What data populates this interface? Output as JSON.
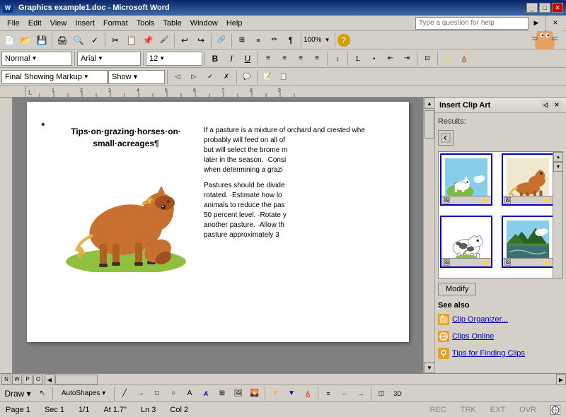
{
  "titlebar": {
    "title": "Graphics example1.doc - Microsoft Word",
    "buttons": [
      "_",
      "□",
      "✕"
    ]
  },
  "menubar": {
    "items": [
      "File",
      "Edit",
      "View",
      "Insert",
      "Format",
      "Tools",
      "Table",
      "Window",
      "Help"
    ]
  },
  "toolbar1": {
    "search_placeholder": "Type a question for help"
  },
  "toolbar2": {
    "style_value": "Normal",
    "font_value": "Arial",
    "size_value": "12"
  },
  "review_toolbar": {
    "markup_value": "Final Showing Markup",
    "show_label": "Show ▾"
  },
  "document": {
    "title": "Tips·on·grazing·horses·on·\nsmall·acreages¶",
    "bullet": "•",
    "col_right_para1": "If a pasture is a mixture of orchard and crested whea probably will feed on all of but will select the brome m later in the season. Consi when determining a grazi",
    "col_right_para2": "Pastures should be divided rotated. Estimate how lo animals to reduce the pas 50 percent level. Rotate y another pasture. Allow th pasture approximately 3"
  },
  "clip_art_panel": {
    "title": "Insert Clip Art",
    "results_label": "Results:",
    "modify_btn": "Modify",
    "see_also_label": "See also",
    "see_also_items": [
      {
        "icon": "org",
        "label": "Clip Organizer..."
      },
      {
        "icon": "link",
        "label": "Clips Online"
      },
      {
        "icon": "tips",
        "label": "Tips for Finding Clips"
      }
    ]
  },
  "statusbar": {
    "page": "Page 1",
    "sec": "Sec 1",
    "pages": "1/1",
    "at": "At 1.7\"",
    "ln": "Ln 3",
    "col": "Col 2",
    "rec": "REC",
    "trk": "TRK",
    "ext": "EXT",
    "ovr": "OVR"
  },
  "draw_toolbar": {
    "draw_label": "Draw ▾",
    "autoshapes_label": "AutoShapes ▾"
  }
}
